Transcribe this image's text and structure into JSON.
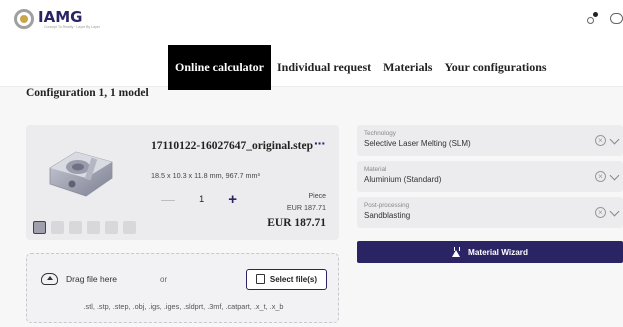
{
  "header": {
    "logo_name": "IAMG",
    "logo_tagline": "Concept To Reality · Layer By Layer"
  },
  "nav": [
    {
      "label": "Online calculator",
      "active": true
    },
    {
      "label": "Individual request",
      "active": false
    },
    {
      "label": "Materials",
      "active": false
    },
    {
      "label": "Your configurations",
      "active": false
    }
  ],
  "config_title": "Configuration 1, 1 model",
  "part": {
    "name": "17110122-16027647_original.step",
    "more": "···",
    "dimensions": "18.5 x 10.3 x 11.8 mm, 967.7 mm³",
    "quantity": "1",
    "minus": "—",
    "plus": "+",
    "price_label": "Piece",
    "unit_price": "EUR 187.71",
    "total": "EUR 187.71"
  },
  "upload": {
    "drag_text": "Drag file here",
    "or_text": "or",
    "button_label": "Select file(s)",
    "formats": ".stl, .stp, .step, .obj, .igs, .iges, .sldprt, .3mf, .catpart, .x_t, .x_b"
  },
  "options": [
    {
      "label": "Technology",
      "value": "Selective Laser Melting (SLM)"
    },
    {
      "label": "Material",
      "value": "Aluminium (Standard)"
    },
    {
      "label": "Post-processing",
      "value": "Sandblasting"
    }
  ],
  "wizard_label": "Material Wizard",
  "icons": {
    "share": "share-icon",
    "chat": "chat-icon",
    "upload": "cloud-upload-icon",
    "document": "document-icon",
    "flask": "flask-icon",
    "clear": "clear-icon",
    "chevron": "chevron-down-icon"
  },
  "colors": {
    "accent": "#2b2464",
    "nav_active_bg": "#000000",
    "card_bg": "#ececee"
  }
}
